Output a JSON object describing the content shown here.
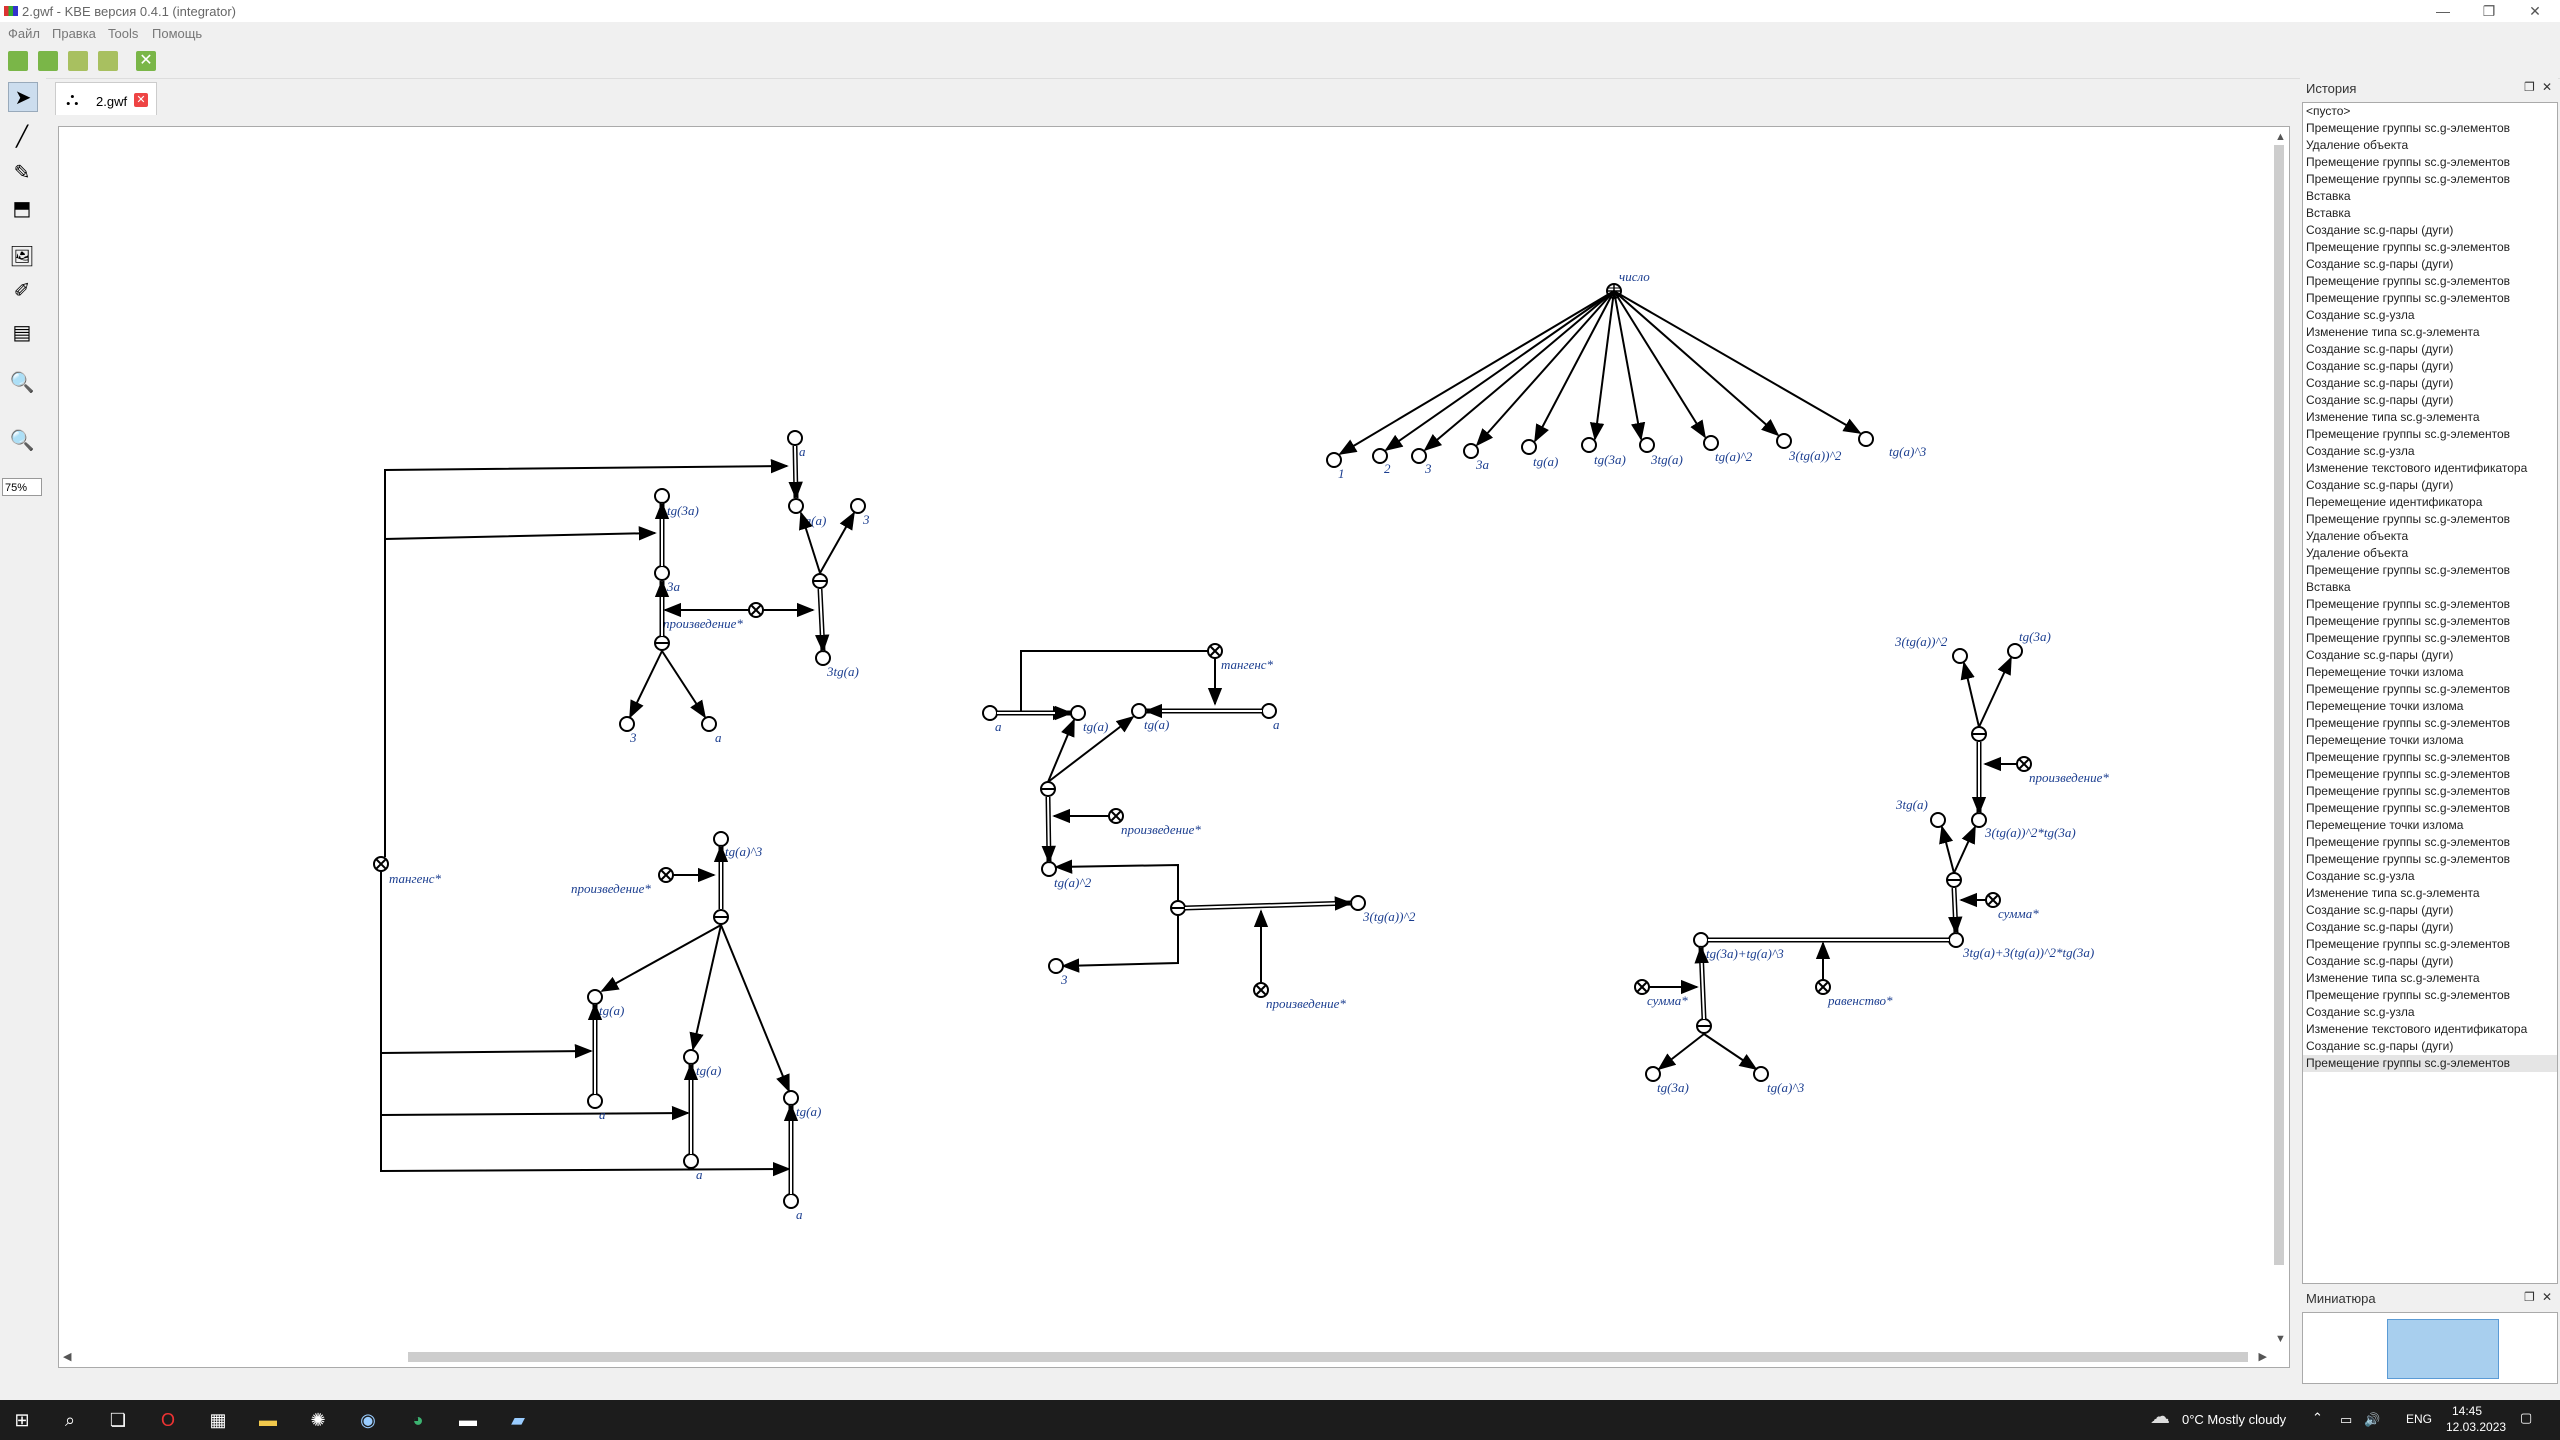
{
  "window": {
    "title": "2.gwf - KBE версия 0.4.1  (integrator)"
  },
  "menu": [
    "Файл",
    "Правка",
    "Tools",
    "Помощь"
  ],
  "zoom": {
    "value": "75%"
  },
  "tab": {
    "label": "2.gwf"
  },
  "history": {
    "title": "История",
    "items": [
      "<пусто>",
      "Премещение группы sc.g-элементов",
      "Удаление объекта",
      "Премещение группы sc.g-элементов",
      "Премещение группы sc.g-элементов",
      "Вставка",
      "Вставка",
      "Создание sc.g-пары (дуги)",
      "Премещение группы sc.g-элементов",
      "Создание sc.g-пары (дуги)",
      "Премещение группы sc.g-элементов",
      "Премещение группы sc.g-элементов",
      "Создание sc.g-узла",
      "Изменение типа sc.g-элемента",
      "Создание sc.g-пары (дуги)",
      "Создание sc.g-пары (дуги)",
      "Создание sc.g-пары (дуги)",
      "Создание sc.g-пары (дуги)",
      "Изменение типа sc.g-элемента",
      "Премещение группы sc.g-элементов",
      "Создание sc.g-узла",
      "Изменение текстового идентификатора",
      "Создание sc.g-пары (дуги)",
      "Перемещение идентификатора",
      "Премещение группы sc.g-элементов",
      "Удаление объекта",
      "Удаление объекта",
      "Премещение группы sc.g-элементов",
      "Вставка",
      "Премещение группы sc.g-элементов",
      "Премещение группы sc.g-элементов",
      "Премещение группы sc.g-элементов",
      "Создание sc.g-пары (дуги)",
      "Перемещение точки излома",
      "Премещение группы sc.g-элементов",
      "Перемещение точки излома",
      "Премещение группы sc.g-элементов",
      "Перемещение точки излома",
      "Премещение группы sc.g-элементов",
      "Премещение группы sc.g-элементов",
      "Премещение группы sc.g-элементов",
      "Премещение группы sc.g-элементов",
      "Перемещение точки излома",
      "Премещение группы sc.g-элементов",
      "Премещение группы sc.g-элементов",
      "Создание sc.g-узла",
      "Изменение типа sc.g-элемента",
      "Создание sc.g-пары (дуги)",
      "Создание sc.g-пары (дуги)",
      "Премещение группы sc.g-элементов",
      "Создание sc.g-пары (дуги)",
      "Изменение типа sc.g-элемента",
      "Премещение группы sc.g-элементов",
      "Создание sc.g-узла",
      "Изменение текстового идентификатора",
      "Создание sc.g-пары (дуги)",
      "Премещение группы sc.g-элементов"
    ],
    "selected_index": 56
  },
  "minimap": {
    "title": "Миниатюра"
  },
  "graph_labels": {
    "chislo": "число",
    "n1": "1",
    "n2": "2",
    "n3": "3",
    "n3a": "3a",
    "tga": "tg(a)",
    "tg3a": "tg(3a)",
    "n3tga": "3tg(a)",
    "tga2": "tg(a)^2",
    "n3tga2": "3(tg(a))^2",
    "tga3": "tg(a)^3",
    "a": "a",
    "tg_3a": "tg(3a)",
    "three_a": "3a",
    "tg_a": "tg(a)",
    "three": "3",
    "three_tga": "3tg(a)",
    "proizvedenie": "произведение*",
    "three_b": "3",
    "a_b": "a",
    "tangens": "тангенс*",
    "proizv2": "произведение*",
    "tga3b": "tg(a)^3",
    "tga_c": "tg(a)",
    "a_c": "a",
    "tga_d": "tg(a)",
    "a_d": "a",
    "tga_e": "tg(a)",
    "a_e": "a",
    "tangens2": "тангенс*",
    "a_m": "a",
    "tga_m1": "tg(a)",
    "tga_m2": "tg(a)",
    "a_m2": "a",
    "proizv3": "произведение*",
    "tga2_m": "tg(a)^2",
    "three_m": "3",
    "n3tga2_m": "3(tg(a))^2",
    "proizv4": "произведение*",
    "r3tga2": "3(tg(a))^2",
    "rtg3a": "tg(3a)",
    "rproizv": "произведение*",
    "r3tga": "3tg(a)",
    "rprod2": "3(tg(a))^2*tg(3a)",
    "rsumma": "сумма*",
    "rsum_big": "3tg(a)+3(tg(a))^2*tg(3a)",
    "rtg3a_tga3": "tg(3a)+tg(a)^3",
    "rsumma2": "сумма*",
    "ravenstvo": "равенство*",
    "rtg3a_b": "tg(3a)",
    "rtga3": "tg(a)^3"
  },
  "taskbar": {
    "weather": "0°C  Mostly cloudy",
    "lang": "ENG",
    "time": "14:45",
    "date": "12.03.2023"
  },
  "colors": {
    "label": "#1a3d8f",
    "selection": "#e5e5e5",
    "minimap_view": "#a8cfee"
  }
}
